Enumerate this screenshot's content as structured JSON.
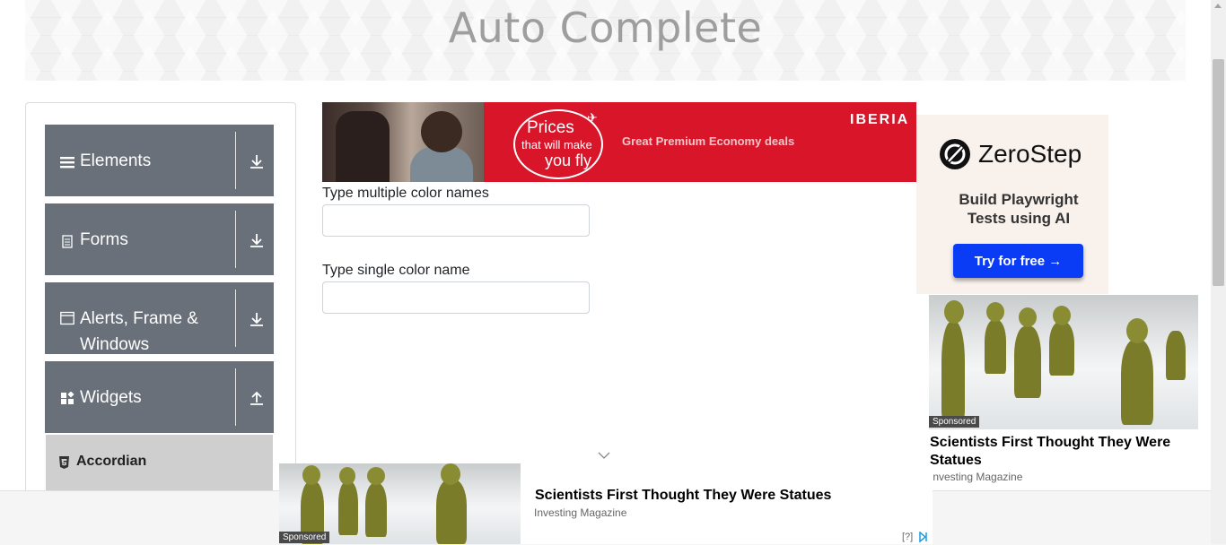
{
  "header": {
    "title": "Auto Complete"
  },
  "sidebar": {
    "groups": [
      {
        "label": "Elements",
        "icon": "hamburger-icon",
        "arrow": "download-arrow-icon"
      },
      {
        "label": "Forms",
        "icon": "document-icon",
        "arrow": "download-arrow-icon"
      },
      {
        "label": "Alerts, Frame & Windows",
        "icon": "window-icon",
        "arrow": "download-arrow-icon"
      },
      {
        "label": "Widgets",
        "icon": "widgets-icon",
        "arrow": "upload-arrow-icon"
      }
    ],
    "active_item": {
      "label": "Accordian",
      "icon": "html5-icon"
    }
  },
  "form": {
    "multiple_label": "Type multiple color names",
    "multiple_value": "",
    "single_label": "Type single color name",
    "single_value": ""
  },
  "ads": {
    "top": {
      "line1": "Prices",
      "line2": "that will make",
      "line3": "you fly",
      "deals": "Great Premium Economy deals",
      "brand": "IBERIA",
      "accent": "#d9152a"
    },
    "zerostep": {
      "name": "ZeroStep",
      "tagline": "Build Playwright Tests using AI",
      "button": "Try for free →",
      "button_color": "#0b3cf5"
    },
    "right_native": {
      "sponsored": "Sponsored",
      "title": "Scientists First Thought They Were Statues",
      "source": "Investing Magazine"
    },
    "bottom": {
      "sponsored": "Sponsored",
      "title": "Scientists First Thought They Were Statues",
      "source": "Investing Magazine",
      "info": "[?]"
    }
  }
}
